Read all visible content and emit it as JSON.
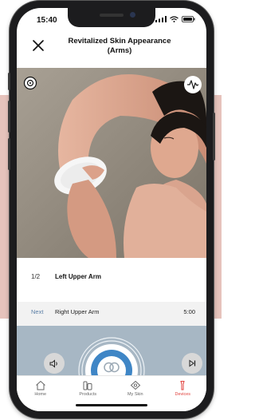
{
  "status_bar": {
    "time": "15:40"
  },
  "header": {
    "title_line1": "Revitalized Skin Appearance",
    "title_line2": "(Arms)"
  },
  "step": {
    "count": "1/2",
    "area": "Left Upper Arm"
  },
  "next": {
    "label": "Next",
    "area": "Right Upper Arm",
    "time": "5:00"
  },
  "tabs": [
    {
      "label": "Home",
      "icon": "home-icon"
    },
    {
      "label": "Products",
      "icon": "products-icon"
    },
    {
      "label": "My Skin",
      "icon": "my-skin-icon"
    },
    {
      "label": "Devices",
      "icon": "devices-icon"
    }
  ],
  "active_tab": "Devices",
  "colors": {
    "accent": "#e0403c",
    "next_label": "#5b7fa6",
    "player_bg": "#a7b7c4",
    "backdrop_band": "#e6c3bc"
  },
  "icons": {
    "close": "close-icon",
    "top_left": "target-icon",
    "top_right": "wave-icon",
    "volume": "volume-icon",
    "play": "play-icon",
    "skip": "skip-icon"
  }
}
